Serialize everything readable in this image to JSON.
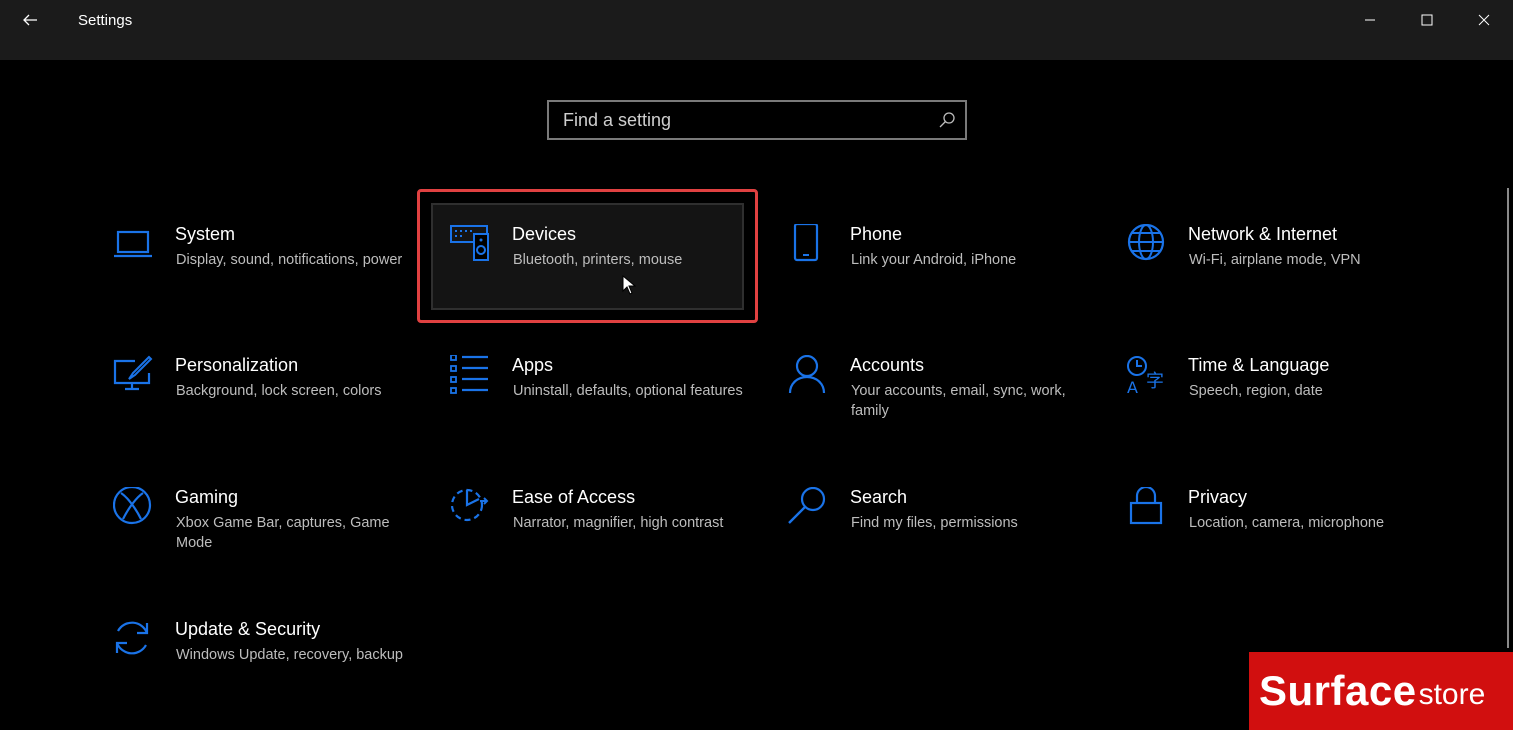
{
  "window": {
    "title": "Settings",
    "back_icon": "back-arrow-icon",
    "controls": [
      "minimize-icon",
      "maximize-icon",
      "close-icon"
    ]
  },
  "search": {
    "placeholder": "Find a setting",
    "value": "",
    "icon": "search-icon"
  },
  "colors": {
    "accent": "#1a73e8",
    "highlight_border": "#e04141",
    "background": "#000000",
    "titlebar": "#1b1b1b",
    "logo_bg": "#d10f0f"
  },
  "categories": [
    {
      "id": "system",
      "title": "System",
      "desc": "Display, sound, notifications, power",
      "icon": "laptop-icon"
    },
    {
      "id": "devices",
      "title": "Devices",
      "desc": "Bluetooth, printers, mouse",
      "icon": "keyboard-speaker-icon"
    },
    {
      "id": "phone",
      "title": "Phone",
      "desc": "Link your Android, iPhone",
      "icon": "phone-icon"
    },
    {
      "id": "network",
      "title": "Network & Internet",
      "desc": "Wi-Fi, airplane mode, VPN",
      "icon": "globe-icon"
    },
    {
      "id": "personalization",
      "title": "Personalization",
      "desc": "Background, lock screen, colors",
      "icon": "paint-brush-monitor-icon"
    },
    {
      "id": "apps",
      "title": "Apps",
      "desc": "Uninstall, defaults, optional features",
      "icon": "apps-list-icon"
    },
    {
      "id": "accounts",
      "title": "Accounts",
      "desc": "Your accounts, email, sync, work, family",
      "icon": "person-icon"
    },
    {
      "id": "time-language",
      "title": "Time & Language",
      "desc": "Speech, region, date",
      "icon": "time-language-icon"
    },
    {
      "id": "gaming",
      "title": "Gaming",
      "desc": "Xbox Game Bar, captures, Game Mode",
      "icon": "xbox-icon"
    },
    {
      "id": "ease-of-access",
      "title": "Ease of Access",
      "desc": "Narrator, magnifier, high contrast",
      "icon": "ease-of-access-icon"
    },
    {
      "id": "search",
      "title": "Search",
      "desc": "Find my files, permissions",
      "icon": "magnifier-icon"
    },
    {
      "id": "privacy",
      "title": "Privacy",
      "desc": "Location, camera, microphone",
      "icon": "lock-icon"
    },
    {
      "id": "update-security",
      "title": "Update & Security",
      "desc": "Windows Update, recovery, backup",
      "icon": "sync-arrows-icon"
    }
  ],
  "highlighted_category": "devices",
  "watermark": {
    "main": "Surface",
    "sub": "store"
  }
}
